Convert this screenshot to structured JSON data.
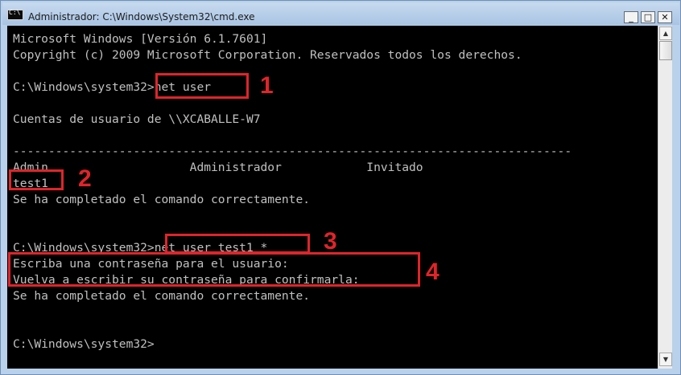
{
  "window": {
    "title": "Administrador: C:\\Windows\\System32\\cmd.exe",
    "icon_text": "C:\\",
    "buttons": {
      "minimize": "_",
      "maximize": "□",
      "close": "✕"
    }
  },
  "console": {
    "lines": [
      "Microsoft Windows [Versión 6.1.7601]",
      "Copyright (c) 2009 Microsoft Corporation. Reservados todos los derechos.",
      "",
      "C:\\Windows\\system32>net user",
      "",
      "Cuentas de usuario de \\\\XCABALLE-W7",
      "",
      "-------------------------------------------------------------------------------",
      "Admin                    Administrador            Invitado",
      "test1",
      "Se ha completado el comando correctamente.",
      "",
      "",
      "C:\\Windows\\system32>net user test1 *",
      "Escriba una contraseña para el usuario:",
      "Vuelva a escribir su contraseña para confirmarla:",
      "Se ha completado el comando correctamente.",
      "",
      "",
      "C:\\Windows\\system32>"
    ]
  },
  "annotations": {
    "labels": [
      "1",
      "2",
      "3",
      "4"
    ],
    "color": "#e0242a"
  },
  "scrollbar": {
    "up_arrow": "▲",
    "down_arrow": "▼"
  },
  "colors": {
    "console_bg": "#000000",
    "console_text": "#c0c0c0",
    "titlebar": "#b9d1ea"
  }
}
